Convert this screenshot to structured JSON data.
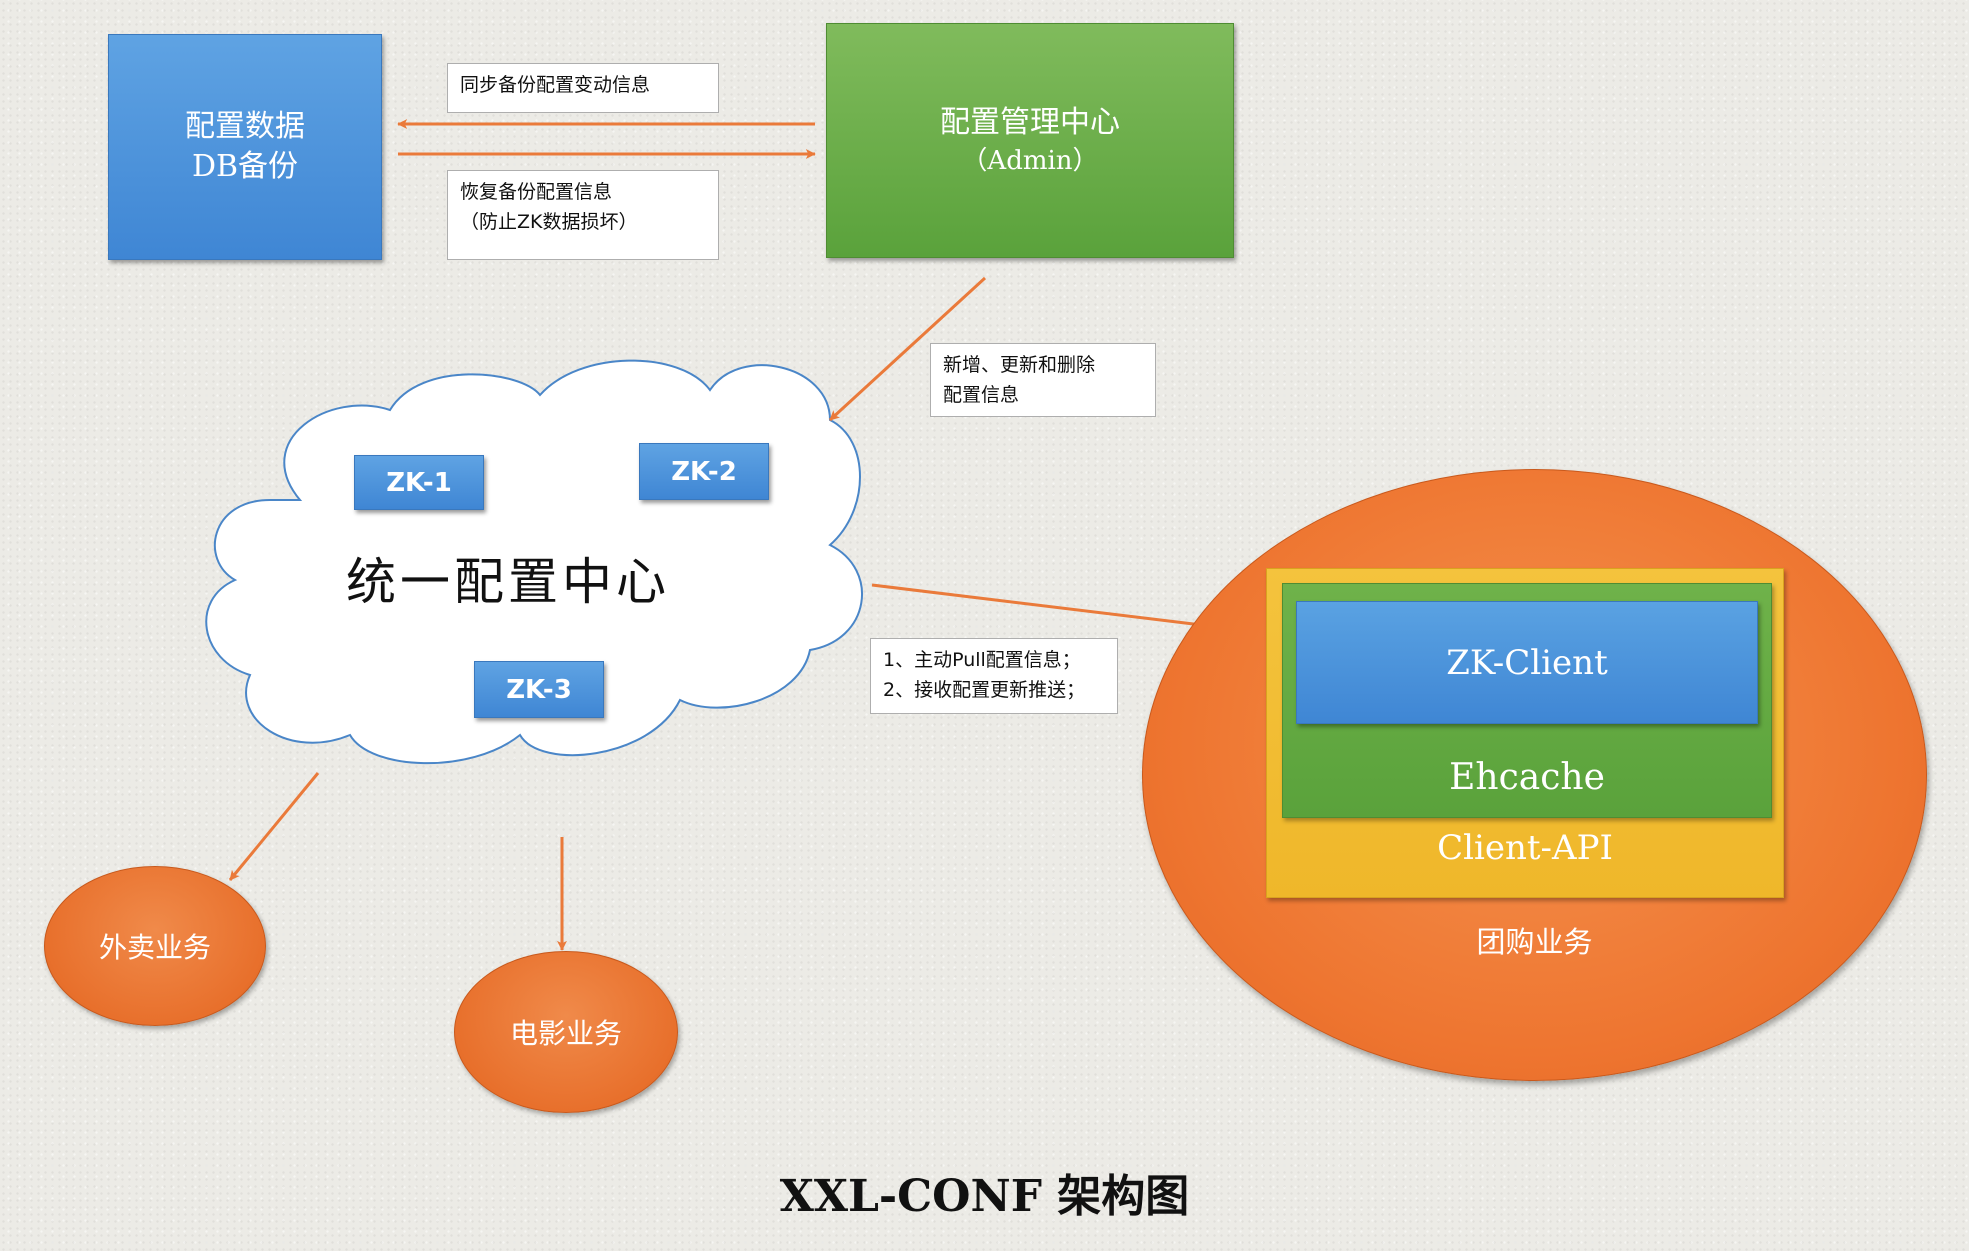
{
  "config_db": {
    "line1": "配置数据",
    "line2": "DB备份"
  },
  "admin": {
    "line1": "配置管理中心",
    "line2": "（Admin）"
  },
  "notes": {
    "sync": "同步备份配置变动信息",
    "restore": "恢复备份配置信息\n（防止ZK数据损坏）",
    "crud": "新增、更新和删除\n配置信息",
    "pull": "1、主动Pull配置信息；\n2、接收配置更新推送；"
  },
  "cloud": {
    "title": "统一配置中心",
    "nodes": [
      "ZK-1",
      "ZK-2",
      "ZK-3"
    ]
  },
  "services": {
    "takeout": "外卖业务",
    "movie": "电影业务",
    "groupon": "团购业务"
  },
  "client_stack": {
    "zk_client": "ZK-Client",
    "ehcache": "Ehcache",
    "client_api": "Client-API"
  },
  "footer": {
    "title": "XXL-CONF 架构图"
  },
  "colors": {
    "arrow": "#ea7a3a",
    "cloud_stroke": "#4a86c8",
    "blue": "#4a90d9",
    "green": "#6aac45",
    "orange": "#ee7530",
    "yellow": "#f1bc32"
  }
}
